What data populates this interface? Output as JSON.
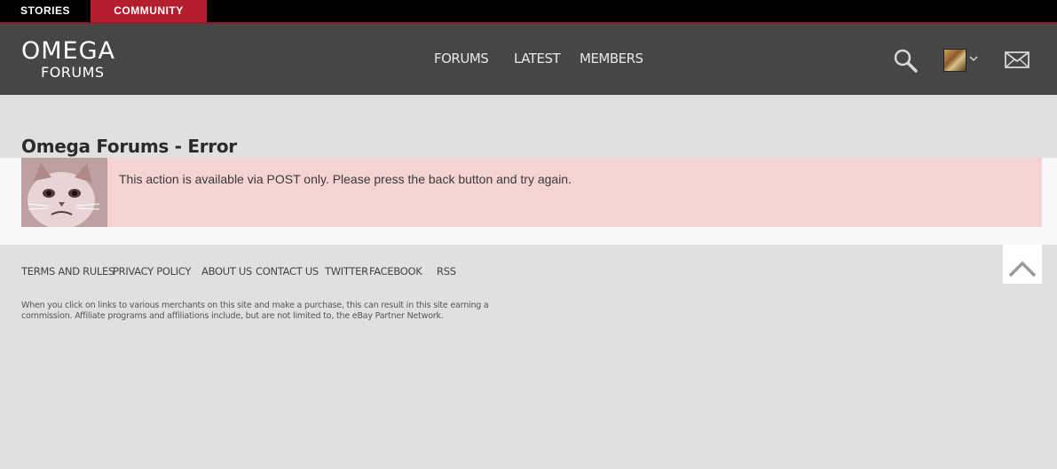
{
  "topbar": {
    "stories": "STORIES",
    "community": "COMMUNITY",
    "community_color": "#b41e2d"
  },
  "header": {
    "logo_main": "OMEGA",
    "logo_sub": "FORUMS",
    "nav": {
      "forums": "FORUMS",
      "latest": "LATEST",
      "members": "MEMBERS"
    },
    "icons": {
      "search": "search-icon",
      "account": "avatar",
      "menu": "chevron-down-icon",
      "inbox": "mail-icon"
    }
  },
  "main": {
    "title": "Omega Forums - Error",
    "error_message": "This action is available via POST only. Please press the back button and try again.",
    "error_background": "#f4d3d1"
  },
  "footer": {
    "links": {
      "terms": "TERMS AND RULES",
      "privacy": "PRIVACY POLICY",
      "about": "ABOUT US",
      "contact": "CONTACT US",
      "twitter": "TWITTER",
      "facebook": "FACEBOOK",
      "rss": "RSS"
    },
    "disclaimer": "When you click on links to various merchants on this site and make a purchase, this can result in this site earning a commission. Affiliate programs and affiliations include, but are not limited to, the eBay Partner Network."
  }
}
